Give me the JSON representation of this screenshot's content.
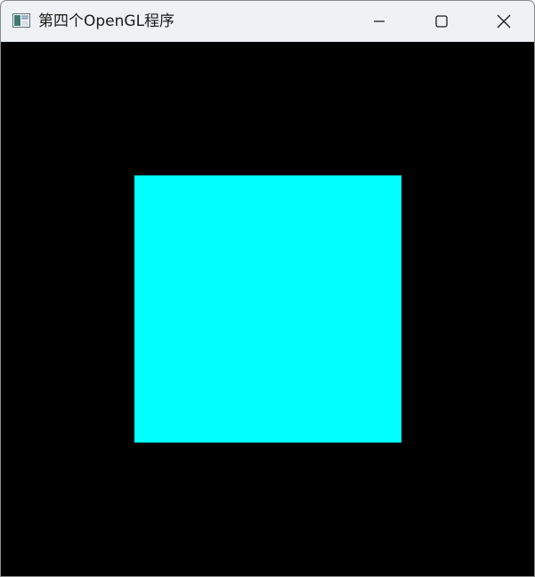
{
  "window": {
    "title": "第四个OpenGL程序",
    "icon": "app-window-icon",
    "controls": {
      "minimize": "minimize-icon",
      "maximize": "maximize-icon",
      "close": "close-icon"
    }
  },
  "canvas": {
    "background": "#000000",
    "quad_color": "#00ffff"
  }
}
